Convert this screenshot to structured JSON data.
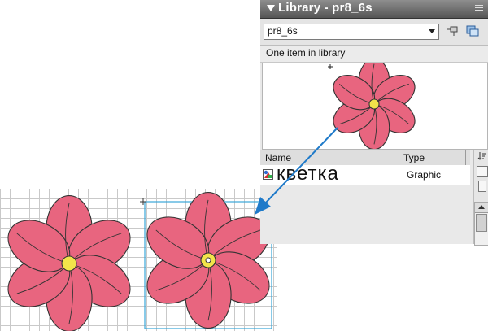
{
  "library": {
    "title": "Library - pr8_6s",
    "document_select": "pr8_6s",
    "status": "One item in library",
    "columns": {
      "name": "Name",
      "type": "Type"
    },
    "items": [
      {
        "name": "кветка",
        "type": "Graphic",
        "icon": "graphic-symbol-icon"
      }
    ]
  },
  "colors": {
    "petal": "#e8657f",
    "center": "#f2e44a",
    "outline": "#333333",
    "selection": "#3aa7d8",
    "arrow": "#1f7ac9",
    "grid": "#c9c9c9"
  }
}
